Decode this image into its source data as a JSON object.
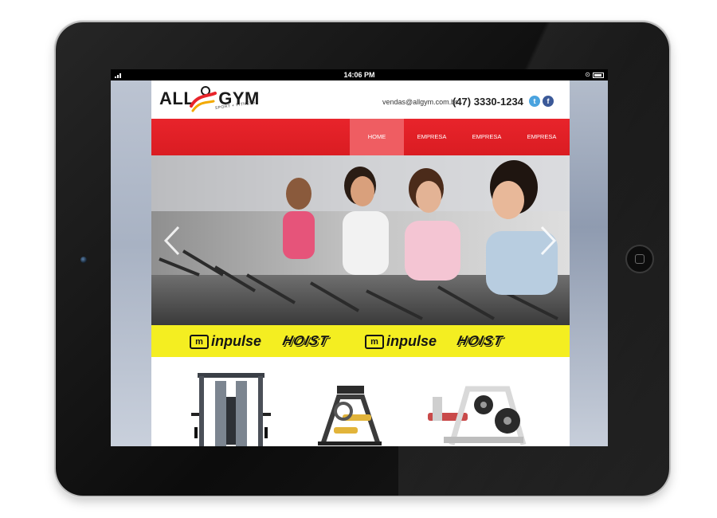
{
  "status_bar": {
    "time": "14:06 PM"
  },
  "site": {
    "logo": {
      "text_left": "ALL",
      "text_right": "GYM",
      "tagline": "SPORT + FITNESS"
    },
    "contact": {
      "email": "vendas@allgym.com.br",
      "phone": "(47) 3330-1234"
    },
    "social": [
      {
        "name": "twitter",
        "glyph": "t"
      },
      {
        "name": "facebook",
        "glyph": "f"
      }
    ],
    "nav": [
      {
        "label": "HOME",
        "active": true
      },
      {
        "label": "EMPRESA",
        "active": false
      },
      {
        "label": "EMPRESA",
        "active": false
      },
      {
        "label": "EMPRESA",
        "active": false
      }
    ],
    "brands": [
      {
        "badge": "m",
        "name": "inpulse"
      },
      {
        "name": "HOIST"
      },
      {
        "badge": "m",
        "name": "inpulse"
      },
      {
        "name": "HOIST"
      }
    ]
  },
  "colors": {
    "nav_red": "#e8242b",
    "nav_active": "#ef5d62",
    "brand_yellow": "#f4ee21",
    "twitter": "#4aa3df",
    "facebook": "#3b5998"
  },
  "icons": {
    "twitter": "twitter-icon",
    "facebook": "facebook-icon",
    "prev": "chevron-left-icon",
    "next": "chevron-right-icon"
  }
}
